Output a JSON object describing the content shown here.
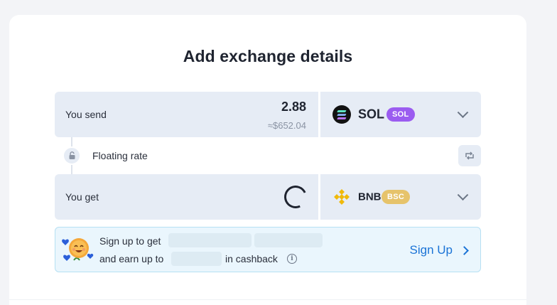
{
  "page": {
    "title": "Add exchange details"
  },
  "send": {
    "label": "You send",
    "amount": "2.88",
    "amount_usd": "≈$652.04",
    "coin": "SOL",
    "network": "SOL",
    "coin_icon": "solana-icon",
    "network_color": "#9b5cf0"
  },
  "rate": {
    "label": "Floating rate",
    "lock_icon": "unlock-icon",
    "swap_icon": "swap-arrows-icon"
  },
  "receive": {
    "label": "You get",
    "loading": true,
    "coin": "BNB",
    "network": "BSC",
    "coin_icon": "bnb-icon",
    "network_color": "#e6c36b"
  },
  "promo": {
    "line1_prefix": "Sign up to get",
    "line2_prefix": "and earn up to",
    "line2_suffix": "in cashback",
    "info_glyph": "i",
    "signup_label": "Sign Up",
    "accent_color": "#1a73d6"
  }
}
